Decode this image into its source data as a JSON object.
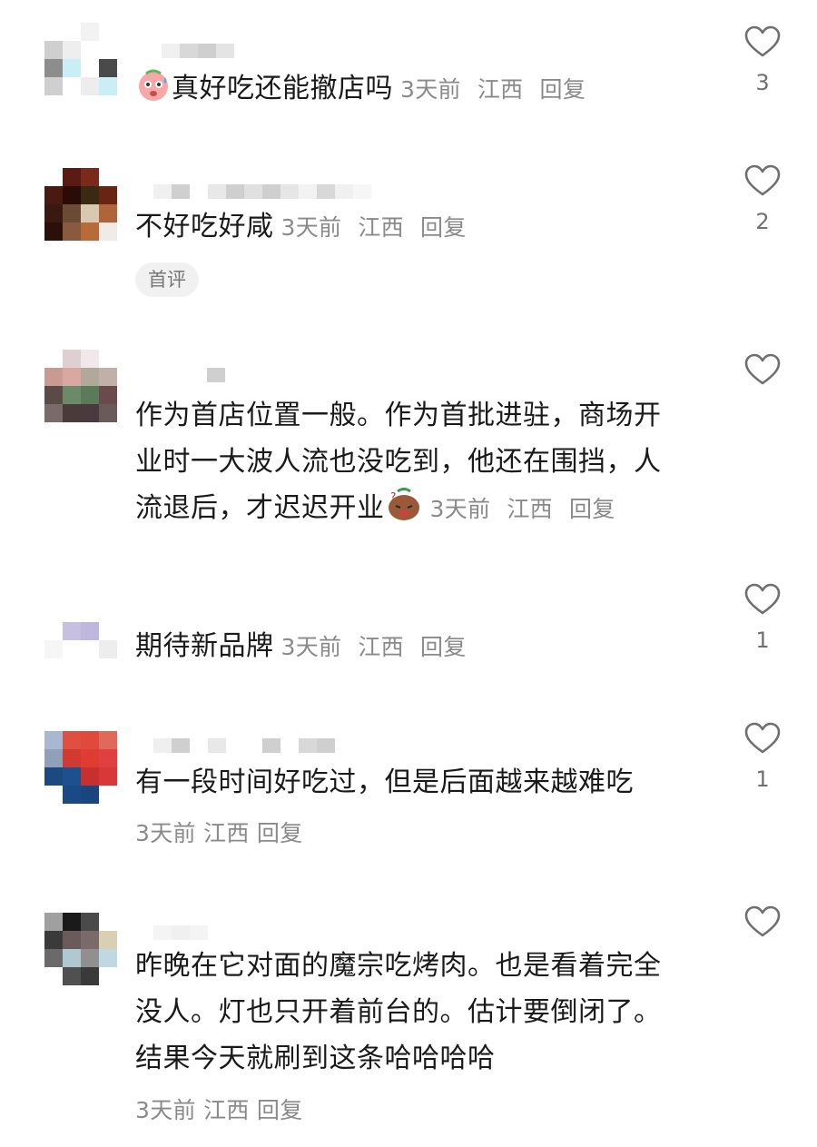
{
  "comments": [
    {
      "text": "真好吃还能撤店吗",
      "time": "3天前",
      "location": "江西",
      "reply_label": "回复",
      "likes": "3",
      "emoji": "sweat-face-emoji"
    },
    {
      "text": "不好吃好咸",
      "time": "3天前",
      "location": "江西",
      "reply_label": "回复",
      "likes": "2",
      "badge": "首评"
    },
    {
      "text_lines": [
        "作为首店位置一般。作为首批进驻，商场开",
        "业时一大波人流也没吃到，他还在围挡，人",
        "流退后，才迟迟开业"
      ],
      "time": "3天前",
      "location": "江西",
      "reply_label": "回复",
      "likes": "",
      "emoji": "confused-face-emoji"
    },
    {
      "text": "期待新品牌",
      "time": "3天前",
      "location": "江西",
      "reply_label": "回复",
      "likes": "1"
    },
    {
      "text": "有一段时间好吃过，但是后面越来越难吃",
      "time": "3天前",
      "location": "江西",
      "reply_label": "回复",
      "likes": "1"
    },
    {
      "text_lines": [
        "昨晚在它对面的魔宗吃烤肉。也是看着完全",
        "没人。灯也只开着前台的。估计要倒闭了。",
        "结果今天就刷到这条哈哈哈哈"
      ],
      "time": "3天前",
      "location": "江西",
      "reply_label": "回复",
      "likes": ""
    }
  ],
  "icons": {
    "like": "heart-outline-icon"
  },
  "colors": {
    "text": "#1a1a1a",
    "meta": "#8a8a8a",
    "badge_bg": "#f1f1f1"
  }
}
